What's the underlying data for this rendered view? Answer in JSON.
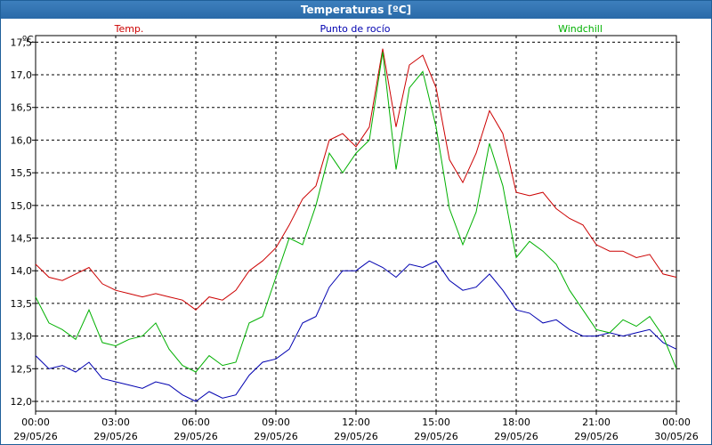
{
  "window": {
    "title": "Temperaturas [ºC]"
  },
  "chart_data": {
    "type": "line",
    "ylabel": "ºC",
    "ylim": [
      11.85,
      17.6
    ],
    "yticks": [
      "12,0",
      "12,5",
      "13,0",
      "13,5",
      "14,0",
      "14,5",
      "15,0",
      "15,5",
      "16,0",
      "16,5",
      "17,0",
      "17,5"
    ],
    "ytick_values": [
      12.0,
      12.5,
      13.0,
      13.5,
      14.0,
      14.5,
      15.0,
      15.5,
      16.0,
      16.5,
      17.0,
      17.5
    ],
    "xlim_hours": [
      0,
      24
    ],
    "xticks": [
      {
        "h": 0,
        "time": "00:00",
        "date": "29/05/26"
      },
      {
        "h": 3,
        "time": "03:00",
        "date": "29/05/26"
      },
      {
        "h": 6,
        "time": "06:00",
        "date": "29/05/26"
      },
      {
        "h": 9,
        "time": "09:00",
        "date": "29/05/26"
      },
      {
        "h": 12,
        "time": "12:00",
        "date": "29/05/26"
      },
      {
        "h": 15,
        "time": "15:00",
        "date": "29/05/26"
      },
      {
        "h": 18,
        "time": "18:00",
        "date": "29/05/26"
      },
      {
        "h": 21,
        "time": "21:00",
        "date": "29/05/26"
      },
      {
        "h": 24,
        "time": "00:00",
        "date": "30/05/26"
      }
    ],
    "grid": true,
    "x_hours": [
      0,
      0.5,
      1,
      1.5,
      2,
      2.5,
      3,
      3.5,
      4,
      4.5,
      5,
      5.5,
      6,
      6.5,
      7,
      7.5,
      8,
      8.5,
      9,
      9.5,
      10,
      10.5,
      11,
      11.5,
      12,
      12.5,
      13,
      13.5,
      14,
      14.5,
      15,
      15.5,
      16,
      16.5,
      17,
      17.5,
      18,
      18.5,
      19,
      19.5,
      20,
      20.5,
      21,
      21.5,
      22,
      22.5,
      23,
      23.5,
      24
    ],
    "series": [
      {
        "name": "Temp.",
        "color": "#cc0000",
        "values": [
          14.1,
          13.9,
          13.85,
          13.95,
          14.05,
          13.8,
          13.7,
          13.65,
          13.6,
          13.65,
          13.6,
          13.55,
          13.4,
          13.6,
          13.55,
          13.7,
          14.0,
          14.15,
          14.35,
          14.7,
          15.1,
          15.3,
          16.0,
          16.1,
          15.9,
          16.2,
          17.4,
          16.2,
          17.15,
          17.3,
          16.8,
          15.7,
          15.35,
          15.8,
          16.45,
          16.1,
          15.2,
          15.15,
          15.2,
          14.95,
          14.8,
          14.7,
          14.4,
          14.3,
          14.3,
          14.2,
          14.25,
          13.95,
          13.9
        ]
      },
      {
        "name": "Punto de rocío",
        "color": "#0000b0",
        "values": [
          12.7,
          12.5,
          12.55,
          12.45,
          12.6,
          12.35,
          12.3,
          12.25,
          12.2,
          12.3,
          12.25,
          12.1,
          12.0,
          12.15,
          12.05,
          12.1,
          12.4,
          12.6,
          12.65,
          12.8,
          13.2,
          13.3,
          13.75,
          14.0,
          14.0,
          14.15,
          14.05,
          13.9,
          14.1,
          14.05,
          14.15,
          13.85,
          13.7,
          13.75,
          13.95,
          13.7,
          13.4,
          13.35,
          13.2,
          13.25,
          13.1,
          13.0,
          13.0,
          13.05,
          13.0,
          13.05,
          13.1,
          12.9,
          12.8
        ]
      },
      {
        "name": "Windchill",
        "color": "#00b000",
        "values": [
          13.6,
          13.2,
          13.1,
          12.95,
          13.4,
          12.9,
          12.85,
          12.95,
          13.0,
          13.2,
          12.8,
          12.55,
          12.45,
          12.7,
          12.55,
          12.6,
          13.2,
          13.3,
          13.9,
          14.5,
          14.4,
          15.0,
          15.8,
          15.5,
          15.8,
          16.0,
          17.35,
          15.55,
          16.8,
          17.05,
          16.2,
          14.95,
          14.4,
          14.9,
          15.95,
          15.3,
          14.2,
          14.45,
          14.3,
          14.1,
          13.7,
          13.4,
          13.1,
          13.05,
          13.25,
          13.15,
          13.3,
          13.0,
          12.5
        ]
      }
    ]
  }
}
